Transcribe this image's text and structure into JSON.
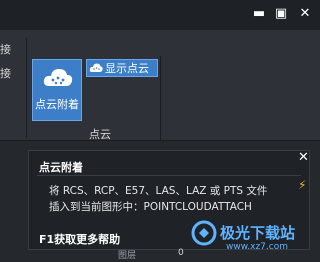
{
  "window": {
    "minimize_glyph": "▬",
    "maximize_glyph": "▣",
    "close_glyph": "✕"
  },
  "left_partial_labels": [
    "接",
    "接"
  ],
  "ribbon": {
    "attach_button": {
      "label": "点云附着",
      "icon": "cloud-icon"
    },
    "show_button": {
      "label": "显示点云",
      "icon": "cloud-icon"
    },
    "group_label": "点云"
  },
  "tooltip": {
    "title": "点云附着",
    "line1": "将 RCS、RCP、E57、LAS、LAZ 或 PTS 文件",
    "line2": "插入到当前图形中：POINTCLOUDATTACH",
    "help": "F1获取更多帮助",
    "close_glyph": "✕"
  },
  "status": {
    "label": "图层",
    "value": "0"
  },
  "watermark": {
    "name": "极光下载站",
    "url": "www.xz7.com"
  },
  "colors": {
    "accent": "#3d7ec8",
    "background": "#2b2e33",
    "watermark": "#5fb3ff"
  }
}
